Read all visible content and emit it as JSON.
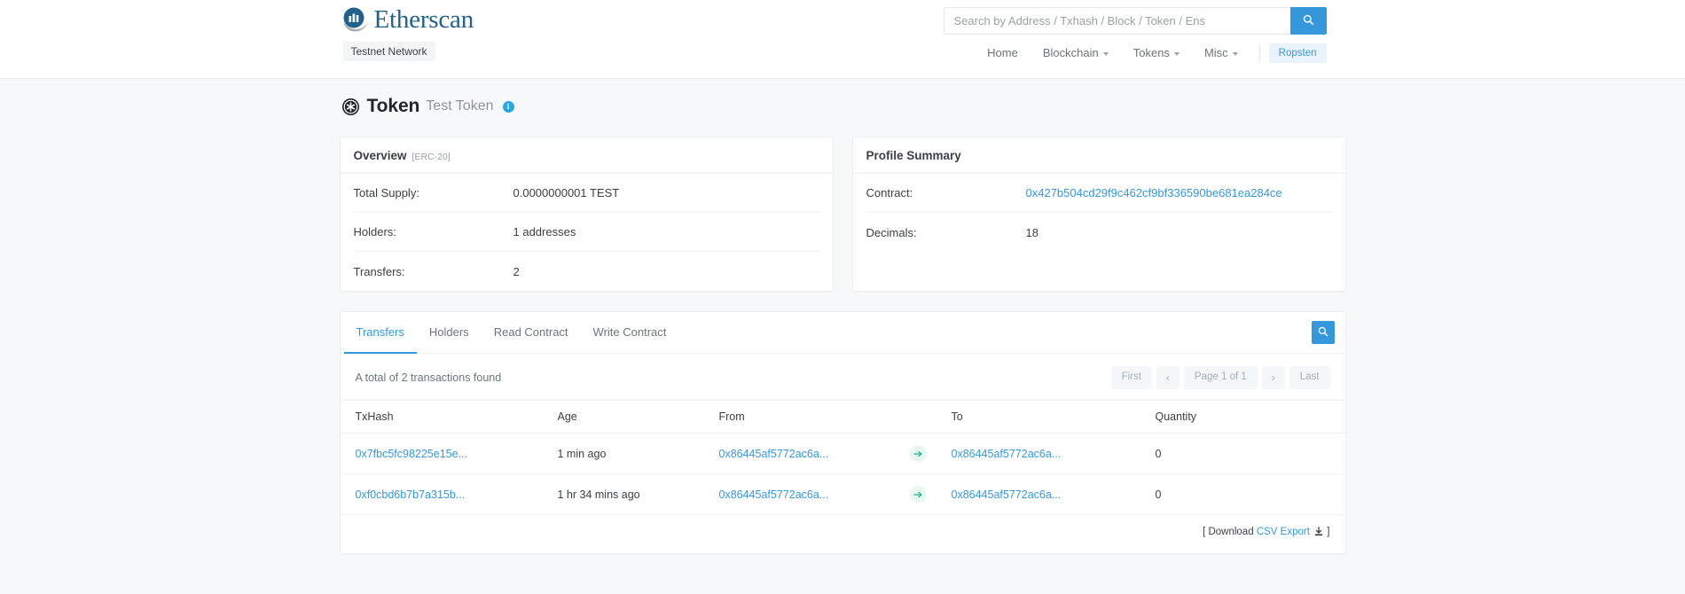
{
  "brand": {
    "name": "Etherscan",
    "logo_icon": "etherscan-logo-icon",
    "network_label": "Testnet Network"
  },
  "search": {
    "placeholder": "Search by Address / Txhash / Block / Token / Ens",
    "value": "",
    "button_icon": "search-icon",
    "accent": "#3498db"
  },
  "nav": {
    "items": [
      {
        "label": "Home",
        "has_caret": false
      },
      {
        "label": "Blockchain",
        "has_caret": true
      },
      {
        "label": "Tokens",
        "has_caret": true
      },
      {
        "label": "Misc",
        "has_caret": true
      }
    ],
    "network_badge": "Ropsten"
  },
  "page": {
    "icon": "token-badge-icon",
    "title": "Token",
    "subtitle": "Test Token",
    "info_icon": "info-icon",
    "info_glyph": "i"
  },
  "overview": {
    "title": "Overview",
    "tag": "[ERC-20]",
    "rows": [
      {
        "key": "Total Supply:",
        "value": "0.0000000001 TEST"
      },
      {
        "key": "Holders:",
        "value": "1 addresses"
      },
      {
        "key": "Transfers:",
        "value": "2"
      }
    ]
  },
  "profile": {
    "title": "Profile Summary",
    "rows": [
      {
        "key": "Contract:",
        "value": "0x427b504cd29f9c462cf9bf336590be681ea284ce",
        "is_link": true
      },
      {
        "key": "Decimals:",
        "value": "18",
        "is_link": false
      }
    ]
  },
  "tabs": {
    "items": [
      {
        "label": "Transfers",
        "active": true
      },
      {
        "label": "Holders",
        "active": false
      },
      {
        "label": "Read Contract",
        "active": false
      },
      {
        "label": "Write Contract",
        "active": false
      }
    ],
    "search_button_icon": "search-icon"
  },
  "toolbar": {
    "count_text": "A total of 2 transactions found",
    "pager": {
      "first": "First",
      "prev": "‹",
      "page_info": "Page 1 of 1",
      "next": "›",
      "last": "Last"
    }
  },
  "table": {
    "columns": [
      "TxHash",
      "Age",
      "From",
      "",
      "To",
      "Quantity"
    ],
    "rows": [
      {
        "txhash": "0x7fbc5fc98225e15e...",
        "age": "1 min ago",
        "from": "0x86445af5772ac6a...",
        "direction_icon": "arrow-right-icon",
        "to": "0x86445af5772ac6a...",
        "quantity": "0"
      },
      {
        "txhash": "0xf0cbd6b7b7a315b...",
        "age": "1 hr 34 mins ago",
        "from": "0x86445af5772ac6a...",
        "direction_icon": "arrow-right-icon",
        "to": "0x86445af5772ac6a...",
        "quantity": "0"
      }
    ]
  },
  "footer": {
    "download_prefix": "[ Download",
    "csv_link": "CSV Export",
    "download_icon": "download-icon",
    "download_suffix": "]"
  }
}
